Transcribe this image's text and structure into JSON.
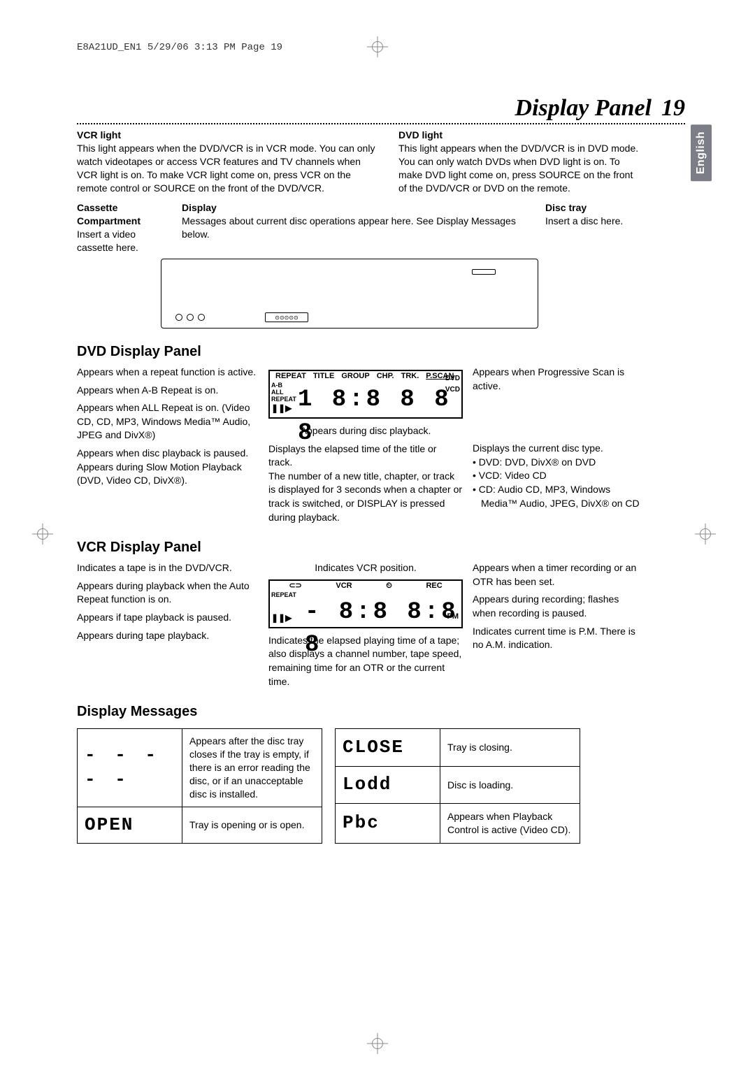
{
  "meta": {
    "header": "E8A21UD_EN1  5/29/06  3:13 PM  Page 19"
  },
  "lang_tab": "English",
  "title": {
    "text": "Display Panel",
    "page": "19"
  },
  "vcr_light": {
    "heading": "VCR light",
    "body": "This light appears when the DVD/VCR is in VCR mode. You can only watch videotapes or access VCR features and TV channels when VCR light is on. To make VCR light come on, press VCR on the remote control or SOURCE on the front of the DVD/VCR."
  },
  "dvd_light": {
    "heading": "DVD light",
    "body": "This light appears when the DVD/VCR is in DVD mode. You can only watch DVDs when DVD light is on. To make DVD light come on, press SOURCE on the front of the DVD/VCR or DVD on the remote."
  },
  "cassette": {
    "heading": "Cassette Compartment",
    "body": "Insert a video cassette here."
  },
  "display": {
    "heading": "Display",
    "body": "Messages about current disc operations appear here. See Display Messages below."
  },
  "disc_tray": {
    "heading": "Disc tray",
    "body": "Insert a disc here."
  },
  "dvd_panel": {
    "heading": "DVD Display Panel",
    "repeat": "Appears when a repeat function is active.",
    "ab": "Appears when A-B Repeat is on.",
    "all": "Appears when ALL Repeat is on. (Video CD, CD, MP3, Windows Media™ Audio, JPEG and DivX®)",
    "paused": "Appears when disc playback is paused.",
    "slow": "Appears during Slow Motion Playback (DVD, Video CD, DivX®).",
    "playback": "Appears during disc playback.",
    "elapsed": "Displays the elapsed time of the title or track.",
    "number": "The number of a new title, chapter, or track is displayed for 3 seconds when a chapter or track is switched, or DISPLAY is pressed during playback.",
    "pscan": "Appears when Progressive Scan is active.",
    "disctype": "Displays the current disc type.",
    "dt1": "• DVD: DVD, DivX® on DVD",
    "dt2": "• VCD: Video CD",
    "dt3": "• CD:  Audio CD, MP3, Windows Media™ Audio, JPEG, DivX® on CD",
    "labels": {
      "repeat": "REPEAT",
      "title": "TITLE",
      "group": "GROUP",
      "chp": "CHP.",
      "trk": "TRK.",
      "pscan": "P.SCAN",
      "ab": "A-B",
      "all": "ALL",
      "repeat2": "REPEAT",
      "dvd": "DVD",
      "vcd": "VCD",
      "seg": "1 8:8 8 8 8"
    }
  },
  "vcr_panel": {
    "heading": "VCR Display Panel",
    "pos": "Indicates VCR position.",
    "tape_in": "Indicates a tape is in the DVD/VCR.",
    "autorep": "Appears during playback when the Auto Repeat function is on.",
    "paused": "Appears if tape playback is paused.",
    "playback": "Appears during tape playback.",
    "timer": "Appears when a timer recording or an OTR has been set.",
    "rec": "Appears during recording; flashes when recording is paused.",
    "pm": "Indicates current time is P.M. There is no A.M. indication.",
    "elapsed": "Indicates the elapsed playing time of a tape; also displays a channel number, tape speed, remaining time for an OTR or the current time.",
    "labels": {
      "vcr": "VCR",
      "rec": "REC",
      "pm": "PM",
      "repeat": "REPEAT",
      "seg": "- 8:8 8:8 8"
    }
  },
  "messages": {
    "heading": "Display Messages",
    "rows_a": [
      {
        "code": "- - - - -",
        "desc": "Appears after the disc tray closes if the tray is empty, if there is an error reading the disc, or if an unacceptable disc is installed."
      },
      {
        "code": "OPEN",
        "desc": "Tray is opening or is open."
      }
    ],
    "rows_b": [
      {
        "code": "CLOSE",
        "desc": "Tray is closing."
      },
      {
        "code": "Lodd",
        "desc": "Disc is loading."
      },
      {
        "code": "Pbc",
        "desc": "Appears when Playback Control is active (Video CD)."
      }
    ]
  }
}
